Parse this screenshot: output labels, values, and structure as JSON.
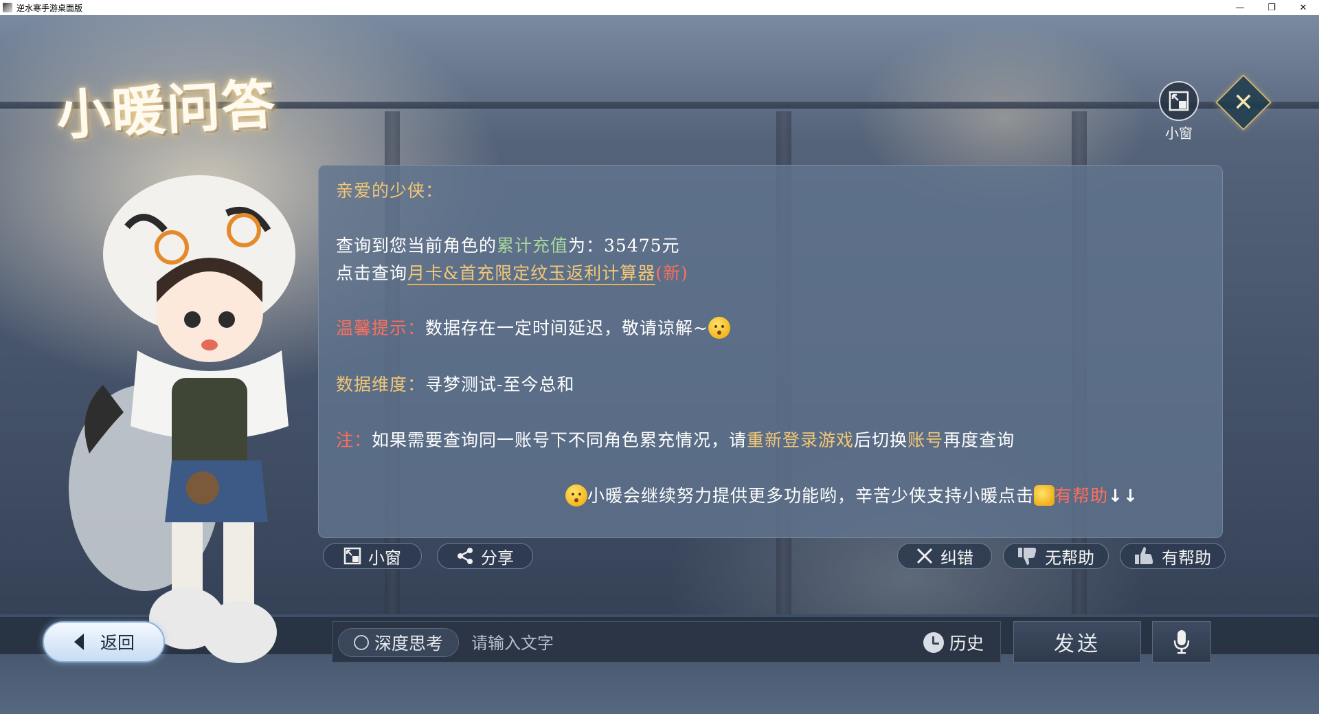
{
  "window": {
    "title": "逆水寒手游桌面版",
    "minimize": "—",
    "maximize": "❐",
    "close": "✕"
  },
  "logo": {
    "text": "小暖问答"
  },
  "top_buttons": {
    "mini_window_label": "小窗",
    "close_icon": "✕"
  },
  "chat": {
    "greeting": "亲爱的少侠：",
    "line1_prefix": "查询到您当前角色的",
    "line1_highlight": "累计充值",
    "line1_suffix": "为：35475元",
    "line2_prefix": "点击查询",
    "line2_link": "月卡&首充限定纹玉返利计算器",
    "line2_new": "(新)",
    "tip_label": "温馨提示：",
    "tip_text": "数据存在一定时间延迟，敬请谅解~",
    "dimension_label": "数据维度：",
    "dimension_text": "寻梦测试-至今总和",
    "note_label": "注：",
    "note_part1": "如果需要查询同一账号下不同角色累充情况，请",
    "note_highlight1": "重新登录游戏",
    "note_part2": "后切换",
    "note_highlight2": "账号",
    "note_part3": "再度查询",
    "footer_text": "小暖会继续努力提供更多功能哟，辛苦少侠支持小暖点击",
    "footer_highlight": "有帮助",
    "footer_arrows": "↓↓"
  },
  "actions": {
    "mini_window": "小窗",
    "share": "分享",
    "correct": "纠错",
    "not_helpful": "无帮助",
    "helpful": "有帮助"
  },
  "bottom": {
    "back": "返回",
    "deep_think": "深度思考",
    "input_placeholder": "请输入文字",
    "input_value": "",
    "history": "历史",
    "send": "发送"
  },
  "colors": {
    "highlight_gold": "#f3c776",
    "highlight_green": "#a9d99a",
    "highlight_red": "#ff6e5c",
    "panel_bg": "#60748e"
  },
  "icons": [
    "app-icon",
    "mini-window-icon",
    "close-icon",
    "share-icon",
    "x-icon",
    "thumbs-down-icon",
    "thumbs-up-icon",
    "back-arrow-icon",
    "clock-icon",
    "mic-icon",
    "emoji-icon"
  ]
}
